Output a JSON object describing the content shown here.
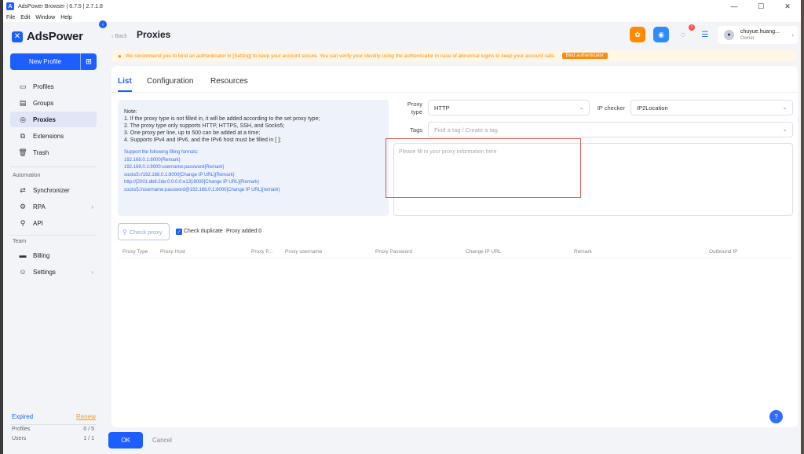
{
  "window": {
    "title": "AdsPower Browser | 6.7.5 | 2.7.1.8",
    "logo_letter": "A",
    "minimize": "—",
    "maximize": "☐",
    "close": "✕"
  },
  "menu": [
    "File",
    "Edit",
    "Window",
    "Help"
  ],
  "sidebar": {
    "brand": "AdsPower",
    "new_profile_label": "New Profile",
    "nav_main": [
      {
        "label": "Profiles",
        "icon": "profiles-icon"
      },
      {
        "label": "Groups",
        "icon": "groups-icon"
      },
      {
        "label": "Proxies",
        "icon": "proxies-icon",
        "active": true
      },
      {
        "label": "Extensions",
        "icon": "extensions-icon"
      },
      {
        "label": "Trash",
        "icon": "trash-icon"
      }
    ],
    "automation_title": "Automation",
    "nav_automation": [
      {
        "label": "Synchronizer"
      },
      {
        "label": "RPA"
      },
      {
        "label": "API"
      }
    ],
    "team_title": "Team",
    "nav_team": [
      {
        "label": "Billing"
      },
      {
        "label": "Settings"
      }
    ],
    "expired_label": "Expired",
    "renew_label": "Renew",
    "quota": [
      {
        "label": "Profiles",
        "value": "0 / 5"
      },
      {
        "label": "Users",
        "value": "1 / 1"
      }
    ]
  },
  "header": {
    "back_label": "Back",
    "title": "Proxies",
    "notification_count": "1",
    "user_name": "chuyue.huang...",
    "user_role": "Owner"
  },
  "banner": {
    "text": "We recommend you to bind an authenticator in [Setting] to keep your account secure. You can verify your identity using the authenticator in case of abnormal logins to keep your account safe.",
    "button": "Bind authenticator"
  },
  "tabs": [
    "List",
    "Configuration",
    "Resources"
  ],
  "note": {
    "lines": [
      "Note:",
      "1. If the proxy type is not filled in, it will be added according to the set proxy type;",
      "2. The proxy type only supports HTTP, HTTPS, SSH, and Socks5;",
      "3. One proxy per line, up to 500 can be added at a time;",
      "4. Supports IPv4 and IPv6, and the IPv6 host must be filled in [ ];"
    ],
    "formats_title": "Support the following filling formats:",
    "formats": [
      "192.168.0.1:8000{Remark}",
      "192.168.0.1:8000:username:password{Remark}",
      "socks5://192.168.0.1:8000[Change IP URL]{Remark}",
      "http://[2001:db8:2de:0:0:0:0:e13]:8000[Change IP URL]{Remark}",
      "socks5://username:password@192.168.0.1:8000[Change IP URL]{remark}"
    ]
  },
  "form": {
    "proxy_type_label_1": "Proxy",
    "proxy_type_label_2": "type",
    "proxy_type_value": "HTTP",
    "ip_checker_label": "IP checker",
    "ip_checker_value": "IP2Location",
    "tags_label": "Tags",
    "tags_placeholder": "Find a tag / Create a tag",
    "proxy_info_placeholder": "Please fill in your proxy information here"
  },
  "actions": {
    "check_proxy": "Check proxy",
    "check_duplicate": "Check duplicate",
    "proxy_added": "Proxy added:0"
  },
  "table_headers": [
    "Proxy Type",
    "Proxy Host",
    "Proxy P...",
    "Proxy username",
    "Proxy Password",
    "Change IP URL",
    "Remark",
    "Outbound IP"
  ],
  "footer": {
    "ok": "OK",
    "cancel": "Cancel"
  }
}
